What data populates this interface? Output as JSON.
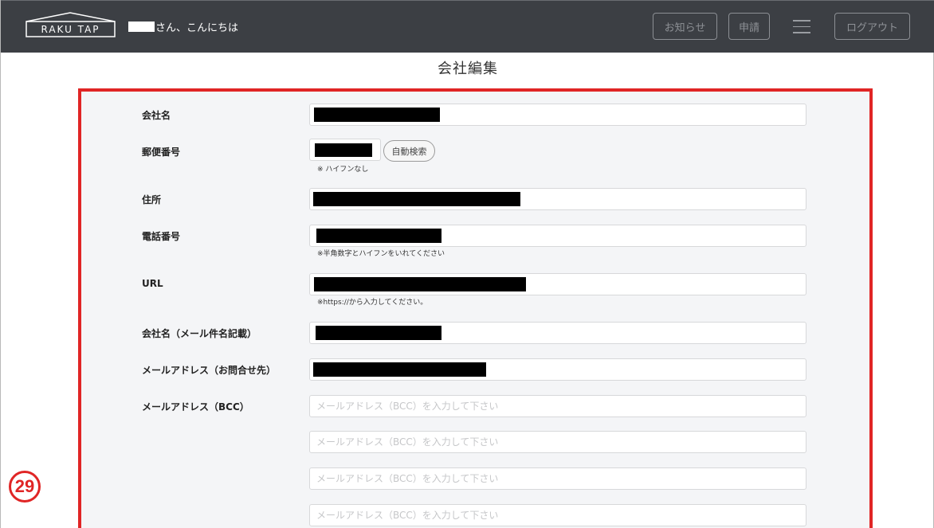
{
  "header": {
    "logo_text": "RAKU TAP",
    "greeting": "さん、こんにちは",
    "buttons": {
      "news": "お知らせ",
      "apply": "申請",
      "logout": "ログアウト"
    }
  },
  "page_title": "会社編集",
  "form": {
    "company_name_label": "会社名",
    "postal_label": "郵便番号",
    "postal_search_button": "自動検索",
    "postal_note": "※ ハイフンなし",
    "address_label": "住所",
    "phone_label": "電話番号",
    "phone_note": "※半角数字とハイフンをいれてください",
    "url_label": "URL",
    "url_note": "※https://から入力してください。",
    "mail_company_label": "会社名（メール件名記載）",
    "contact_email_label": "メールアドレス（お問合せ先）",
    "bcc_label": "メールアドレス（BCC）",
    "bcc_placeholder": "メールアドレス（BCC）を入力して下さい"
  },
  "badge": "29",
  "colors": {
    "header_bg": "#3c3f44",
    "highlight_border": "#e02525",
    "panel_bg": "#f4f5f7"
  }
}
